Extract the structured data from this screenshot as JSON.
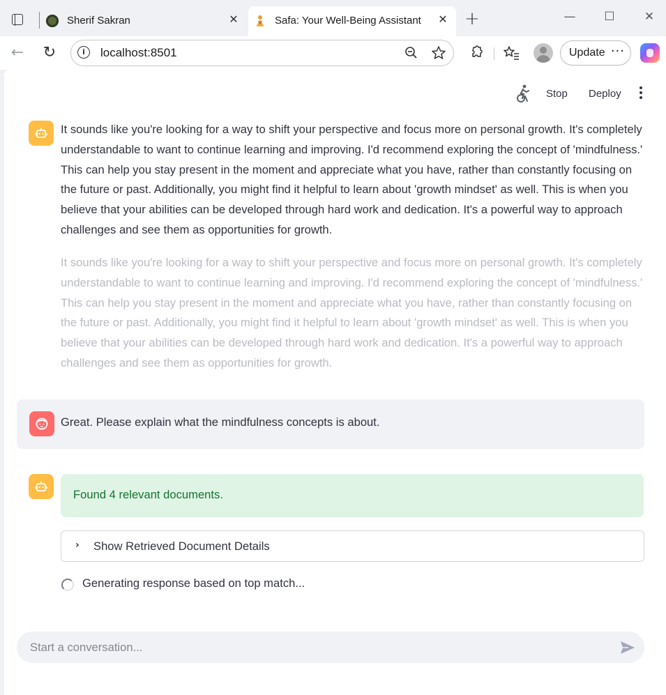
{
  "browser": {
    "tabs": [
      {
        "title": "Sherif Sakran",
        "active": false
      },
      {
        "title": "Safa: Your Well-Being Assistant",
        "active": true
      }
    ],
    "tab_close_glyph": "✕",
    "new_tab_glyph": "+",
    "window_controls": {
      "minimize": "—",
      "maximize": "☐",
      "close": "✕"
    },
    "address_bar": {
      "url": "localhost:8501"
    },
    "update_label": "Update",
    "more_glyph": "···"
  },
  "app": {
    "header": {
      "stop_label": "Stop",
      "deploy_label": "Deploy"
    },
    "messages": {
      "assistant_previous": "It sounds like you're looking for a way to shift your perspective and focus more on personal growth. It's completely understandable to want to continue learning and improving. I'd recommend exploring the concept of 'mindfulness.' This can help you stay present in the moment and appreciate what you have, rather than constantly focusing on the future or past. Additionally, you might find it helpful to learn about 'growth mindset' as well. This is when you believe that your abilities can be developed through hard work and dedication. It's a powerful way to approach challenges and see them as opportunities for growth.",
      "assistant_previous_stale": "It sounds like you're looking for a way to shift your perspective and focus more on personal growth. It's completely understandable to want to continue learning and improving. I'd recommend exploring the concept of 'mindfulness.' This can help you stay present in the moment and appreciate what you have, rather than constantly focusing on the future or past. Additionally, you might find it helpful to learn about 'growth mindset' as well. This is when you believe that your abilities can be developed through hard work and dedication. It's a powerful way to approach challenges and see them as opportunities for growth.",
      "user": "Great. Please explain what the mindfulness concepts is about.",
      "assistant_current": {
        "success": "Found 4 relevant documents.",
        "expander_label": "Show Retrieved Document Details",
        "spinner_text": "Generating response based on top match..."
      }
    },
    "chat_input": {
      "placeholder": "Start a conversation..."
    }
  },
  "colors": {
    "bot_avatar": "#ffbd45",
    "user_avatar": "#ff6b6b",
    "success_bg": "#dff4e4",
    "success_text": "#177233"
  }
}
